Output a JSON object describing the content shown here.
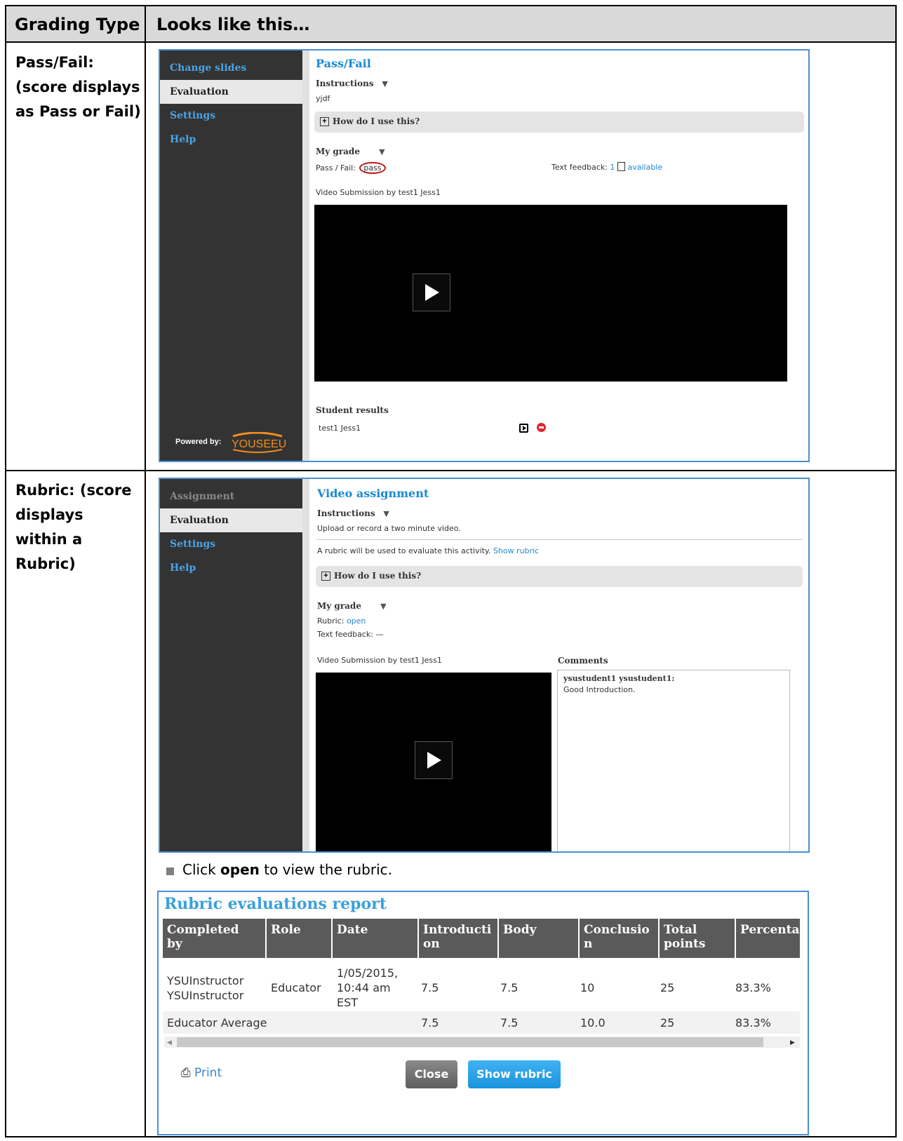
{
  "header": {
    "col1": "Grading Type",
    "col2": "Looks like this…"
  },
  "rows": {
    "passfail_label": [
      "Pass/Fail:",
      "(score displays",
      "as Pass or Fail)"
    ],
    "rubric_label": [
      "Rubric: (score",
      "displays",
      "within a",
      "Rubric)"
    ]
  },
  "app1": {
    "nav": [
      "Change slides",
      "Evaluation",
      "Settings",
      "Help"
    ],
    "powered_by": "Powered by:",
    "logo": "YOUSEEU",
    "title": "Pass/Fail",
    "instructions_label": "Instructions",
    "instructions_text": "yjdf",
    "how_label": "How do I use this?",
    "my_grade": "My grade",
    "passfail_prefix": "Pass / Fail:",
    "passfail_value": "pass",
    "text_feedback_label": "Text feedback:",
    "text_feedback_count": "1",
    "text_feedback_link": "available",
    "video_caption": "Video Submission by test1 Jess1",
    "student_results": "Student results",
    "student_name": "test1 Jess1"
  },
  "app2": {
    "nav": [
      "Assignment",
      "Evaluation",
      "Settings",
      "Help"
    ],
    "title": "Video assignment",
    "instructions_label": "Instructions",
    "instructions_text": "Upload or record a two minute video.",
    "rubric_note": "A rubric will be used to evaluate this activity.",
    "show_rubric_link": "Show rubric",
    "how_label": "How do I use this?",
    "my_grade": "My grade",
    "rubric_prefix": "Rubric:",
    "rubric_link": "open",
    "text_feedback": "Text feedback:  —",
    "video_caption": "Video Submission by test1 Jess1",
    "comments_label": "Comments",
    "comment_author": "ysustudent1 ysustudent1:",
    "comment_text": "Good Introduction."
  },
  "instruction": {
    "pre": "Click ",
    "bold": "open",
    "post": " to view the rubric."
  },
  "report": {
    "title": "Rubric evaluations report",
    "columns": [
      [
        "Completed",
        "by"
      ],
      [
        "Role",
        ""
      ],
      [
        "Date",
        ""
      ],
      [
        "Introducti",
        "on"
      ],
      [
        "Body",
        ""
      ],
      [
        "Conclusio",
        "n"
      ],
      [
        "Total",
        "points"
      ],
      [
        "Percenta",
        ""
      ]
    ],
    "row1": {
      "completed_by": [
        "YSUInstructor",
        "YSUInstructor"
      ],
      "role": "Educator",
      "date": [
        "1/05/2015,",
        "10:44 am",
        "EST"
      ],
      "introduction": "7.5",
      "body": "7.5",
      "conclusion": "10",
      "total": "25",
      "percentage": "83.3%"
    },
    "avg": {
      "label": "Educator Average",
      "introduction": "7.5",
      "body": "7.5",
      "conclusion": "10.0",
      "total": "25",
      "percentage": "83.3%"
    },
    "print": "Print",
    "close": "Close",
    "show_rubric": "Show rubric"
  }
}
